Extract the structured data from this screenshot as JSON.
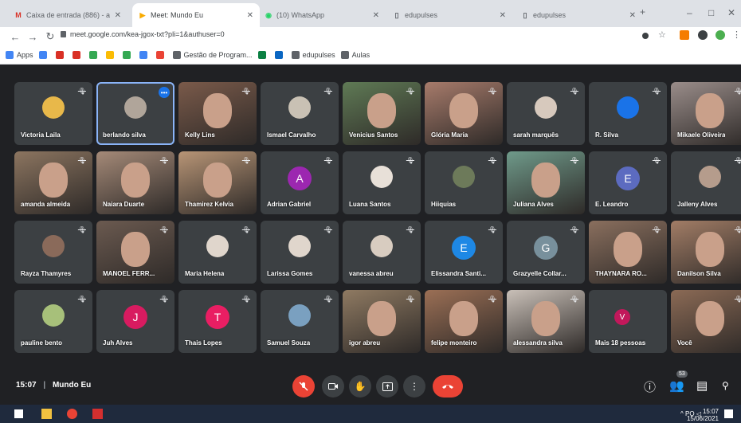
{
  "browser": {
    "tabs": [
      {
        "label": "Caixa de entrada (886) - arte...",
        "color": "#d93025",
        "icon": "gmail-icon",
        "glyph": "M"
      },
      {
        "label": "Meet: Mundo Eu",
        "color": "#f9ab00",
        "icon": "meet-icon",
        "glyph": "▶"
      },
      {
        "label": "(10) WhatsApp",
        "color": "#25d366",
        "icon": "whatsapp-icon",
        "glyph": "◉"
      },
      {
        "label": "edupulses",
        "color": "#5f6368",
        "icon": "page-icon",
        "glyph": "▯"
      },
      {
        "label": "edupulses",
        "color": "#5f6368",
        "icon": "page-icon",
        "glyph": "▯"
      }
    ],
    "url": "meet.google.com/kea-jgox-txt?pli=1&authuser=0",
    "bookmarks": [
      {
        "label": "Apps",
        "color": "#4285f4"
      },
      {
        "label": "",
        "color": "#4285f4"
      },
      {
        "label": "",
        "color": "#d93025"
      },
      {
        "label": "",
        "color": "#d93025"
      },
      {
        "label": "",
        "color": "#34a853"
      },
      {
        "label": "",
        "color": "#fbbc04"
      },
      {
        "label": "",
        "color": "#34a853"
      },
      {
        "label": "",
        "color": "#4285f4"
      },
      {
        "label": "",
        "color": "#ea4335"
      },
      {
        "label": "Gestão de Program...",
        "color": "#5f6368"
      },
      {
        "label": "",
        "color": "#0b8043"
      },
      {
        "label": "",
        "color": "#0a66c2"
      },
      {
        "label": "edupulses",
        "color": "#5f6368"
      },
      {
        "label": "Aulas",
        "color": "#5f6368"
      }
    ]
  },
  "participants": [
    {
      "name": "Victoria Laila",
      "type": "photo",
      "color": "#e8b84a"
    },
    {
      "name": "berlando silva",
      "type": "photo",
      "color": "#b0a59a",
      "selected": true
    },
    {
      "name": "Kelly Lins",
      "type": "video",
      "color": "#7a5a4a"
    },
    {
      "name": "Ismael Carvalho",
      "type": "photo",
      "color": "#c9c1b4"
    },
    {
      "name": "Venicius Santos",
      "type": "video",
      "color": "#5f7a55"
    },
    {
      "name": "Glória Maria",
      "type": "video",
      "color": "#a77b6b"
    },
    {
      "name": "sarah marquês",
      "type": "photo",
      "color": "#d7c9bd"
    },
    {
      "name": "R. Silva",
      "type": "photo",
      "color": "#1a73e8"
    },
    {
      "name": "Mikaele Oliveira",
      "type": "video",
      "color": "#9a8d8a"
    },
    {
      "name": "amanda almeida",
      "type": "video",
      "color": "#8c7560"
    },
    {
      "name": "Naiara Duarte",
      "type": "video",
      "color": "#a58a78"
    },
    {
      "name": "Thamirez Kelvia",
      "type": "video",
      "color": "#b89576"
    },
    {
      "name": "Adrian Gabriel",
      "type": "letter",
      "letter": "A",
      "color": "#9c27b0"
    },
    {
      "name": "Luana Santos",
      "type": "photo",
      "color": "#e8e0d8"
    },
    {
      "name": "Hiiquias",
      "type": "photo",
      "color": "#6d7a5a"
    },
    {
      "name": "Juliana Alves",
      "type": "video",
      "color": "#6f9a8a"
    },
    {
      "name": "E. Leandro",
      "type": "letter",
      "letter": "E",
      "color": "#5c6bc0"
    },
    {
      "name": "Jalleny Alves",
      "type": "photo",
      "color": "#b59c8c"
    },
    {
      "name": "Rayza Thamyres",
      "type": "photo",
      "color": "#8a6a5a"
    },
    {
      "name": "MANOEL FERR...",
      "type": "video",
      "color": "#6b5a50"
    },
    {
      "name": "Maria Helena",
      "type": "photo",
      "color": "#e0d6cc"
    },
    {
      "name": "Larissa Gomes",
      "type": "photo",
      "color": "#e0d6cc"
    },
    {
      "name": "vanessa abreu",
      "type": "photo",
      "color": "#d8ccc0"
    },
    {
      "name": "Elissandra Santi...",
      "type": "letter",
      "letter": "E",
      "color": "#1e88e5"
    },
    {
      "name": "Grazyelle Collar...",
      "type": "letter",
      "letter": "G",
      "color": "#78909c"
    },
    {
      "name": "THAYNARA RO...",
      "type": "video",
      "color": "#8a6f5e"
    },
    {
      "name": "Danilson Silva",
      "type": "video",
      "color": "#a27d66"
    },
    {
      "name": "pauline bento",
      "type": "photo",
      "color": "#a7c07a"
    },
    {
      "name": "Juh Alves",
      "type": "letter",
      "letter": "J",
      "color": "#d81b60"
    },
    {
      "name": "Thais Lopes",
      "type": "letter",
      "letter": "T",
      "color": "#e91e63"
    },
    {
      "name": "Samuel Souza",
      "type": "photo",
      "color": "#7aa0c0"
    },
    {
      "name": "igor abreu",
      "type": "video",
      "color": "#8f7a62"
    },
    {
      "name": "felipe monteiro",
      "type": "video",
      "color": "#9b6f55"
    },
    {
      "name": "alessandra silva",
      "type": "video",
      "color": "#c9c0b8"
    },
    {
      "name": "Mais 18 pessoas",
      "type": "more",
      "color": "#c2185b"
    },
    {
      "name": "Você",
      "type": "video",
      "color": "#8b6a55"
    }
  ],
  "bottom_bar": {
    "time": "15:07",
    "meeting": "Mundo Eu",
    "participant_badge": "53"
  },
  "taskbar": {
    "lang": "PO",
    "time": "15:07",
    "date": "15/06/2021"
  }
}
